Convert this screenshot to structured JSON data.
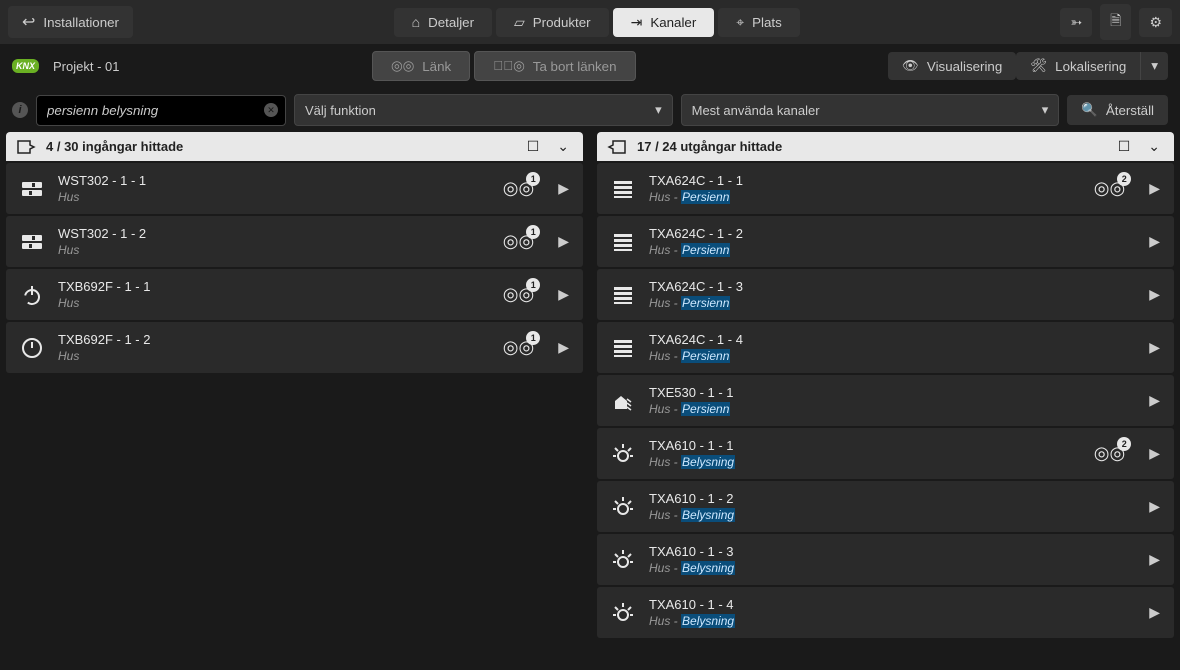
{
  "topbar": {
    "back_label": "Installationer",
    "nav": {
      "details": "Detaljer",
      "products": "Produkter",
      "channels": "Kanaler",
      "location": "Plats"
    }
  },
  "subbar": {
    "knx_label": "KNX",
    "project_title": "Projekt - 01",
    "link_label": "Länk",
    "unlink_label": "Ta bort länken",
    "visualization_label": "Visualisering",
    "localization_label": "Lokalisering"
  },
  "filter": {
    "search_value": "persienn belysning",
    "function_select": "Välj funktion",
    "channel_select": "Mest använda kanaler",
    "reset_label": "Återställ"
  },
  "left": {
    "header": "4 / 30 ingångar hittade",
    "items": [
      {
        "icon": "switch",
        "title": "WST302 - 1 - 1",
        "sub_prefix": "Hus",
        "hl": "",
        "link_count": "1"
      },
      {
        "icon": "switch",
        "title": "WST302 - 1 - 2",
        "sub_prefix": "Hus",
        "hl": "",
        "link_count": "1"
      },
      {
        "icon": "power",
        "title": "TXB692F - 1 - 1",
        "sub_prefix": "Hus",
        "hl": "",
        "link_count": "1"
      },
      {
        "icon": "power-on",
        "title": "TXB692F - 1 - 2",
        "sub_prefix": "Hus",
        "hl": "",
        "link_count": "1"
      }
    ]
  },
  "right": {
    "header": "17 / 24 utgångar hittade",
    "items": [
      {
        "icon": "shutter",
        "title": "TXA624C - 1 - 1",
        "sub_prefix": "Hus - ",
        "hl": "Persienn",
        "link_count": "2"
      },
      {
        "icon": "shutter",
        "title": "TXA624C - 1 - 2",
        "sub_prefix": "Hus - ",
        "hl": "Persienn",
        "link_count": ""
      },
      {
        "icon": "shutter",
        "title": "TXA624C - 1 - 3",
        "sub_prefix": "Hus - ",
        "hl": "Persienn",
        "link_count": ""
      },
      {
        "icon": "shutter",
        "title": "TXA624C - 1 - 4",
        "sub_prefix": "Hus - ",
        "hl": "Persienn",
        "link_count": ""
      },
      {
        "icon": "house",
        "title": "TXE530 - 1 - 1",
        "sub_prefix": "Hus - ",
        "hl": "Persienn",
        "link_count": ""
      },
      {
        "icon": "light",
        "title": "TXA610 - 1 - 1",
        "sub_prefix": "Hus - ",
        "hl": "Belysning",
        "link_count": "2"
      },
      {
        "icon": "light",
        "title": "TXA610 - 1 - 2",
        "sub_prefix": "Hus - ",
        "hl": "Belysning",
        "link_count": ""
      },
      {
        "icon": "light",
        "title": "TXA610 - 1 - 3",
        "sub_prefix": "Hus - ",
        "hl": "Belysning",
        "link_count": ""
      },
      {
        "icon": "light",
        "title": "TXA610 - 1 - 4",
        "sub_prefix": "Hus - ",
        "hl": "Belysning",
        "link_count": ""
      }
    ]
  }
}
